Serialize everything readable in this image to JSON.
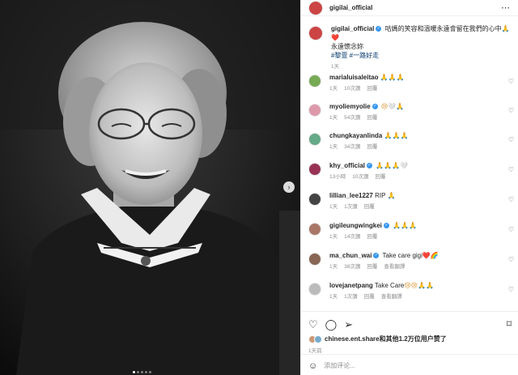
{
  "header": {
    "username": "gigilai_official"
  },
  "caption": {
    "username": "gigilai_official",
    "text": "咕媽的笑容和溫暖永遠會留在我們的心中",
    "text_line2": "永遠懷念妳",
    "emoji": "🙏❤️",
    "tags": "#黎萱 #一路好走",
    "time": "1天"
  },
  "comments": [
    {
      "user": "marialuisaleitao",
      "text": "",
      "emoji": "🙏🙏🙏",
      "time": "1天",
      "likes": "10次讚",
      "reply": "回覆",
      "verified": false
    },
    {
      "user": "myoliemyolie",
      "text": "",
      "emoji": "😢🤍🙏",
      "time": "1天",
      "likes": "54次讚",
      "reply": "回覆",
      "verified": true
    },
    {
      "user": "chungkayanlinda",
      "text": "",
      "emoji": "🙏🙏🙏",
      "time": "1天",
      "likes": "34次讚",
      "reply": "回覆",
      "verified": false
    },
    {
      "user": "khy_official",
      "text": "",
      "emoji": "🙏🙏🙏🤍",
      "time": "13小時",
      "likes": "10次讚",
      "reply": "回覆",
      "verified": true
    },
    {
      "user": "lillian_lee1227",
      "text": "RIP",
      "emoji": "🙏",
      "time": "1天",
      "likes": "1次讚",
      "reply": "回覆",
      "verified": false
    },
    {
      "user": "gigileungwingkei",
      "text": "",
      "emoji": "🙏🙏🙏",
      "time": "1天",
      "likes": "14次讚",
      "reply": "回覆",
      "verified": true
    },
    {
      "user": "ma_chun_wai",
      "text": "Take care gigi",
      "emoji": "❤️🌈",
      "time": "1天",
      "likes": "38次讚",
      "reply": "回覆",
      "extra": "查看翻譯",
      "verified": true
    },
    {
      "user": "lovejanetpang",
      "text": "Take Care",
      "emoji": "😢😢🙏🙏",
      "time": "1天",
      "likes": "1次讚",
      "reply": "回覆",
      "extra": "查看翻譯",
      "verified": false
    }
  ],
  "actions": {
    "liked_by": "chinese.ent.share和其他1.2万位用户赞了",
    "time": "1天前",
    "add_comment_placeholder": "添加评论..."
  },
  "colors": {
    "link": "#00376b",
    "verified": "#3897f0",
    "muted": "#8e8e8e"
  }
}
